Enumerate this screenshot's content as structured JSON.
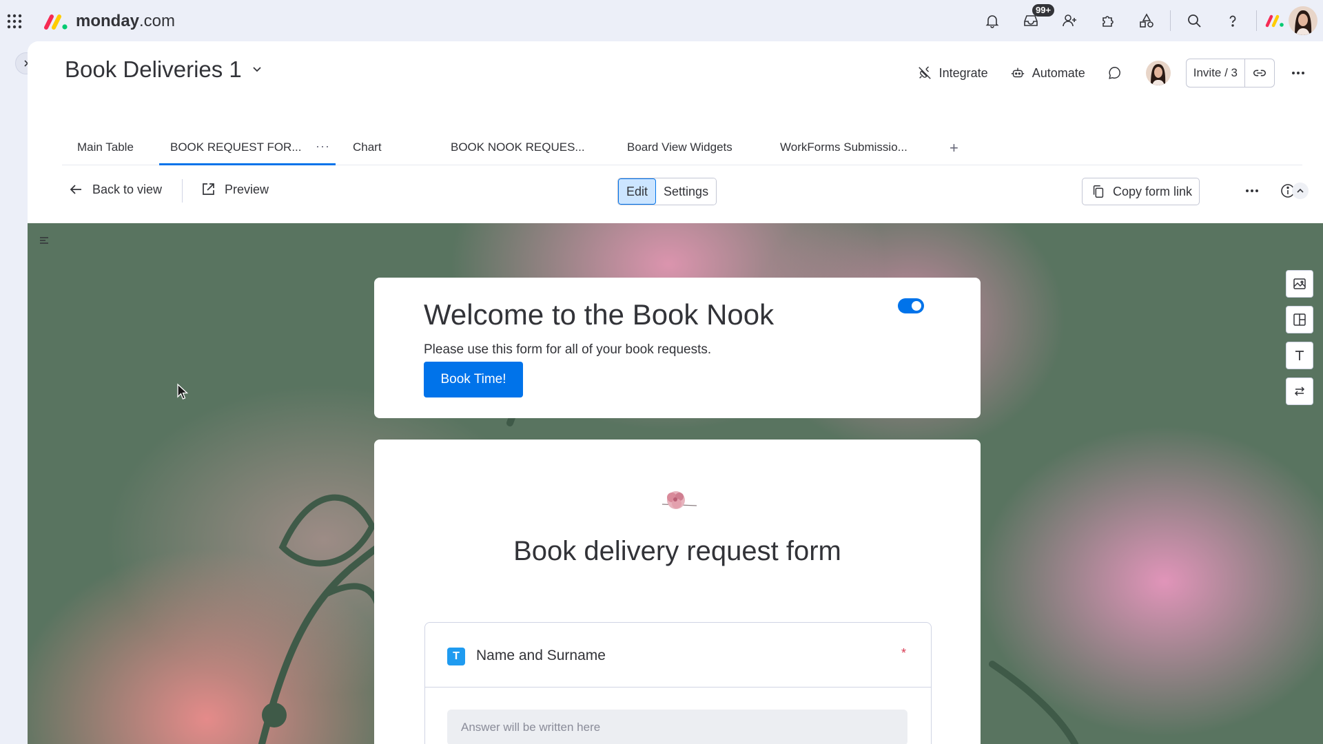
{
  "brand": {
    "name_bold": "monday",
    "name_light": ".com"
  },
  "topbar": {
    "inbox_badge": "99+"
  },
  "board": {
    "title": "Book Deliveries 1",
    "actions": {
      "integrate": "Integrate",
      "automate": "Automate",
      "invite": "Invite / 3"
    }
  },
  "tabs": [
    {
      "label": "Main Table"
    },
    {
      "label": "BOOK REQUEST FOR..."
    },
    {
      "label": "Chart"
    },
    {
      "label": "BOOK NOOK REQUES..."
    },
    {
      "label": "Board View Widgets"
    },
    {
      "label": "WorkForms Submissio..."
    }
  ],
  "tab_more": "···",
  "tab_add": "+",
  "toolbar": {
    "back": "Back to view",
    "preview": "Preview",
    "edit": "Edit",
    "settings": "Settings",
    "copy_link": "Copy form link"
  },
  "welcome": {
    "title": "Welcome to the Book Nook",
    "subtitle": "Please use this form for all of your book requests.",
    "button": "Book Time!"
  },
  "form": {
    "title": "Book delivery request form",
    "question": {
      "type_icon": "T",
      "label": "Name and Surname",
      "required_mark": "*",
      "placeholder": "Answer will be written here"
    }
  },
  "colors": {
    "accent": "#0073ea",
    "canvas_green": "#597460",
    "required": "#d83a52"
  }
}
